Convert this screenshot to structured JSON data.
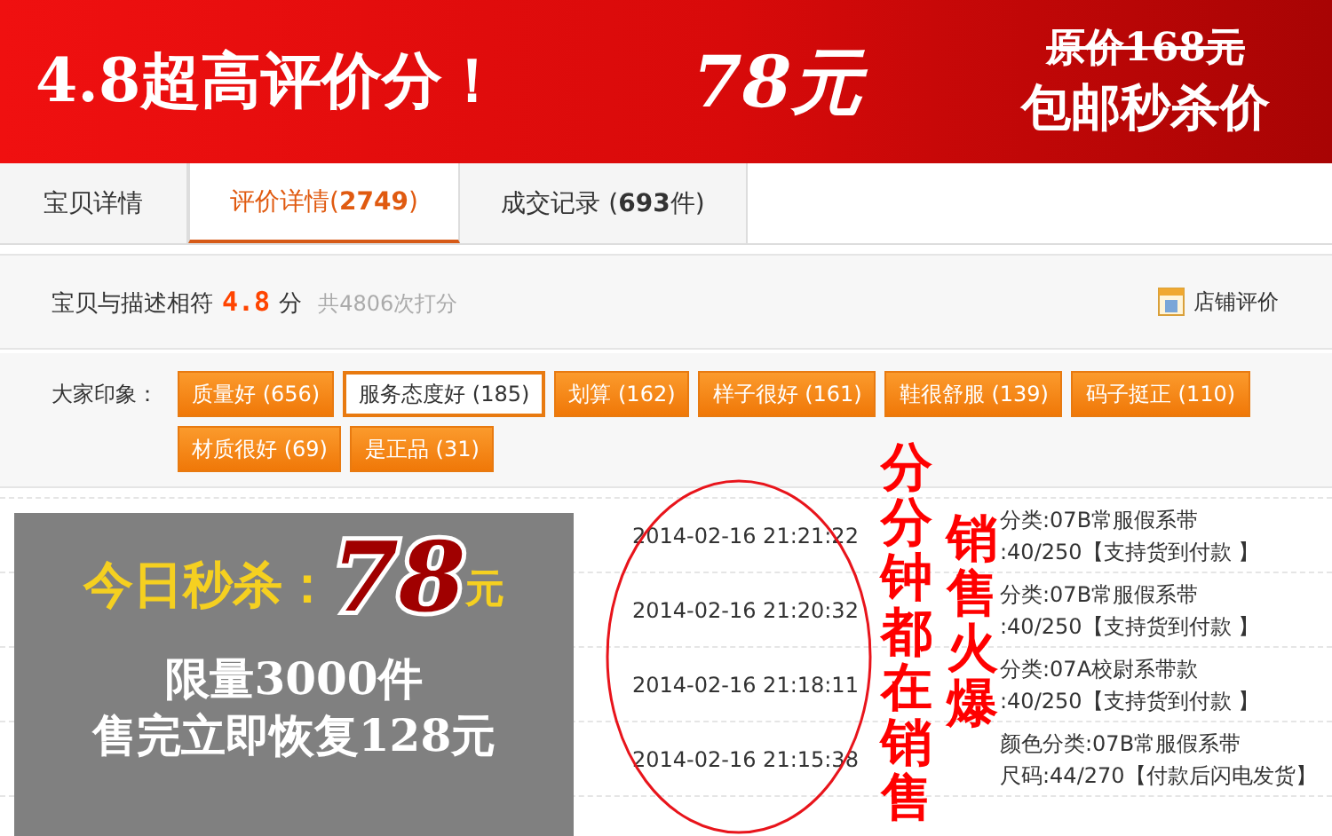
{
  "banner": {
    "headline": "4.8超高评价分！",
    "price": "78元",
    "original_price": "原价168元",
    "tagline": "包邮秒杀价"
  },
  "tabs": [
    {
      "label": "宝贝详情",
      "selected": false
    },
    {
      "label": "评价详情(**2749**)",
      "selected": true
    },
    {
      "label": "成交记录 (**693**件)",
      "selected": false
    }
  ],
  "rating": {
    "label": "宝贝与描述相符",
    "score": "4.8",
    "unit": "分",
    "count": "共4806次打分",
    "shop_link": "店铺评价"
  },
  "impressions": {
    "label": "大家印象：",
    "tags": [
      {
        "label": "质量好 (656)",
        "selected": false
      },
      {
        "label": "服务态度好 (185)",
        "selected": true
      },
      {
        "label": "划算 (162)",
        "selected": false
      },
      {
        "label": "样子很好 (161)",
        "selected": false
      },
      {
        "label": "鞋很舒服 (139)",
        "selected": false
      },
      {
        "label": "码子挺正 (110)",
        "selected": false
      },
      {
        "label": "材质很好 (69)",
        "selected": false
      },
      {
        "label": "是正品 (31)",
        "selected": false
      }
    ]
  },
  "records": [
    {
      "time": "2014-02-16 21:21:22",
      "sku_line_1": "分类:07B常服假系带",
      "sku_line_2": ":40/250【支持货到付款 】"
    },
    {
      "time": "2014-02-16 21:20:32",
      "sku_line_1": "分类:07B常服假系带",
      "sku_line_2": ":40/250【支持货到付款 】"
    },
    {
      "time": "2014-02-16 21:18:11",
      "sku_line_1": "分类:07A校尉系带款",
      "sku_line_2": ":40/250【支持货到付款 】"
    },
    {
      "time": "2014-02-16 21:15:38",
      "sku_line_1": "颜色分类:07B常服假系带",
      "sku_line_2": "尺码:44/270【付款后闪电发货】"
    }
  ],
  "promo_overlay": {
    "title": "今日秒杀：",
    "price": "78",
    "unit": "元",
    "line_1": "限量3000件",
    "line_2": "售完立即恢复128元"
  },
  "annotations": {
    "slogan_1": "分分钟都在销售",
    "slogan_2": "销售火爆"
  }
}
